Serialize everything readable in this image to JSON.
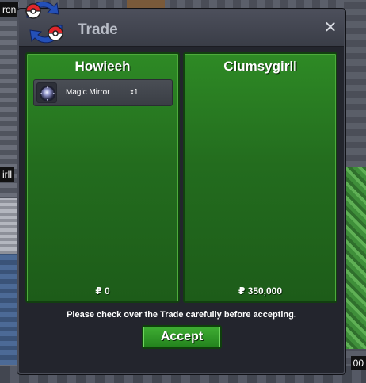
{
  "window": {
    "title": "Trade",
    "close_glyph": "✕",
    "logo_icon": "trade-arrows-icon",
    "colors": {
      "panel_green": "#236c1e",
      "accept_green": "#2f9a27",
      "window_bg": "#23252d"
    }
  },
  "left_panel": {
    "player_name": "Howieeh",
    "items": [
      {
        "icon": "magic-mirror-icon",
        "name": "Magic Mirror",
        "quantity": "x1"
      }
    ],
    "money": "₽ 0"
  },
  "right_panel": {
    "player_name": "Clumsygirll",
    "items": [],
    "money": "₽ 350,000"
  },
  "notice": "Please check over the Trade carefully before accepting.",
  "accept_label": "Accept",
  "background": {
    "tag_top_left": "ron",
    "tag_mid_left": "irll",
    "tag_bottom_right": "00"
  }
}
